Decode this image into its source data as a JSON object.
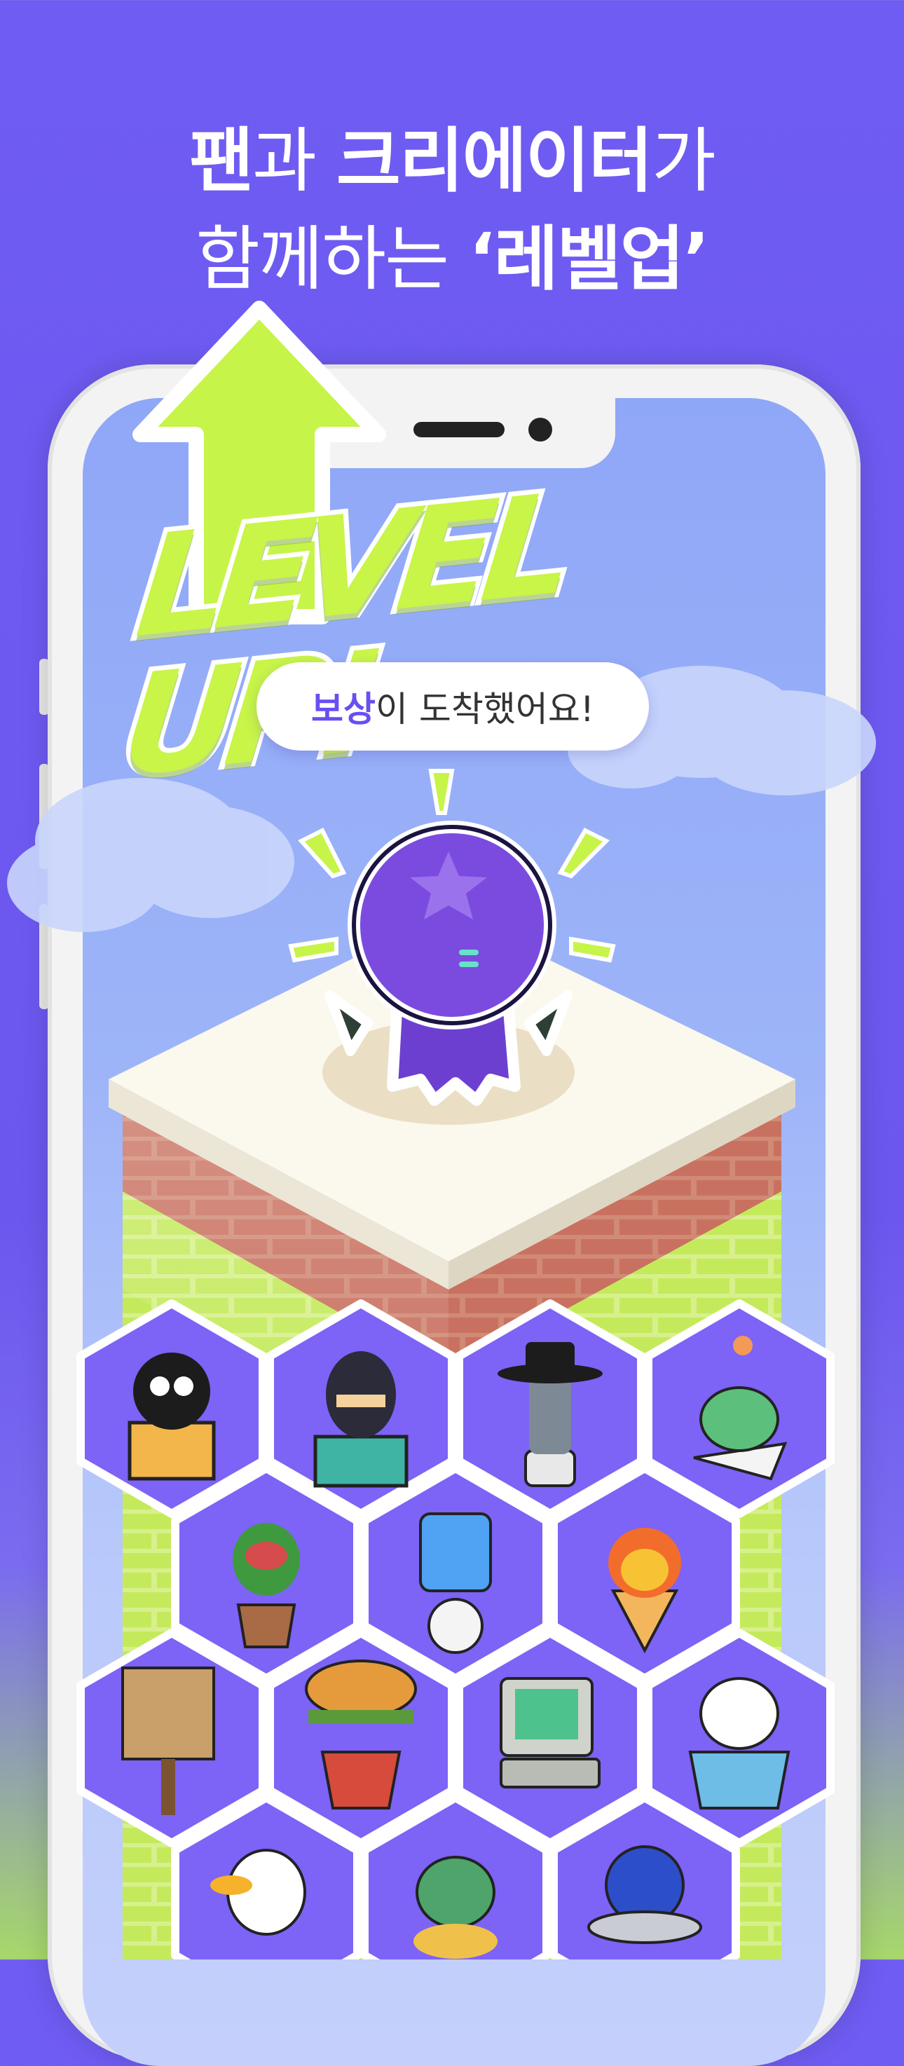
{
  "headline": {
    "line1_bold1": "팬",
    "line1_text1": "과 ",
    "line1_bold2": "크리에이터",
    "line1_text2": "가",
    "line2_text": "함께하는 ",
    "line2_bold": "‘레벨업’"
  },
  "banner": {
    "level_up": "LEVEL UP!"
  },
  "reward": {
    "highlight": "보상",
    "rest": "이 도착했어요!"
  },
  "colors": {
    "background": "#6f5cf3",
    "accent_green": "#c8f548",
    "hex_fill": "#7b62f5",
    "brick": "#c97f6d"
  },
  "characters": [
    "black-cat-in-box",
    "ninja-in-cart",
    "moai-in-hat",
    "frog-with-flower",
    "venus-flytrap-plant",
    "ice-cube-snowman",
    "fire-ice-cream",
    "paper-bag-scarecrow",
    "burger-bucket",
    "retro-computer",
    "dog-in-cup",
    "duck",
    "green-dragon",
    "ufo-globe"
  ],
  "hero_character": "purple-octopus-with-wings"
}
